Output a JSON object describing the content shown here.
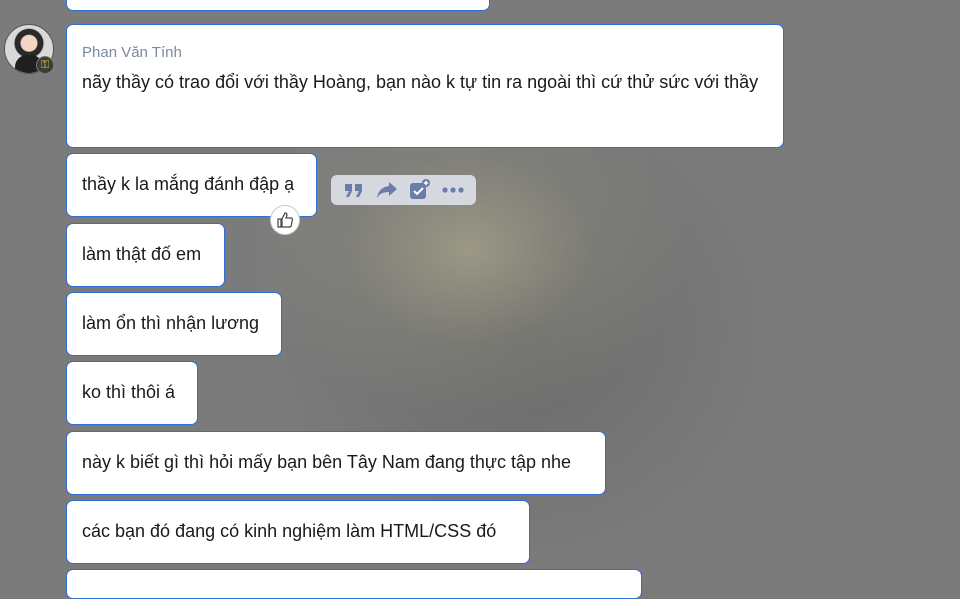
{
  "sender": {
    "name": "Phan Văn Tính"
  },
  "messages": [
    {
      "text": "nãy thầy có trao đổi với thầy Hoàng, bạn nào k tự tin ra ngoài thì cứ thử sức với thầy"
    },
    {
      "text": "thầy k la mắng đánh đập ạ"
    },
    {
      "text": "làm thật đố em"
    },
    {
      "text": "làm ổn thì nhận lương"
    },
    {
      "text": "ko thì thôi á"
    },
    {
      "text": "này k biết gì thì hỏi mấy bạn bên Tây Nam đang thực tập nhe"
    },
    {
      "text": "các bạn đó đang có kinh nghiệm làm HTML/CSS đó"
    }
  ],
  "hover_actions": [
    "quote-icon",
    "forward-icon",
    "add-task-icon",
    "more-icon"
  ],
  "reaction": "thumbs-up-icon",
  "colors": {
    "bubble_border": "#2f6fd6",
    "sender": "#7b8a9c",
    "action_icon": "#6a7da8",
    "background": "#7b7b7b"
  }
}
